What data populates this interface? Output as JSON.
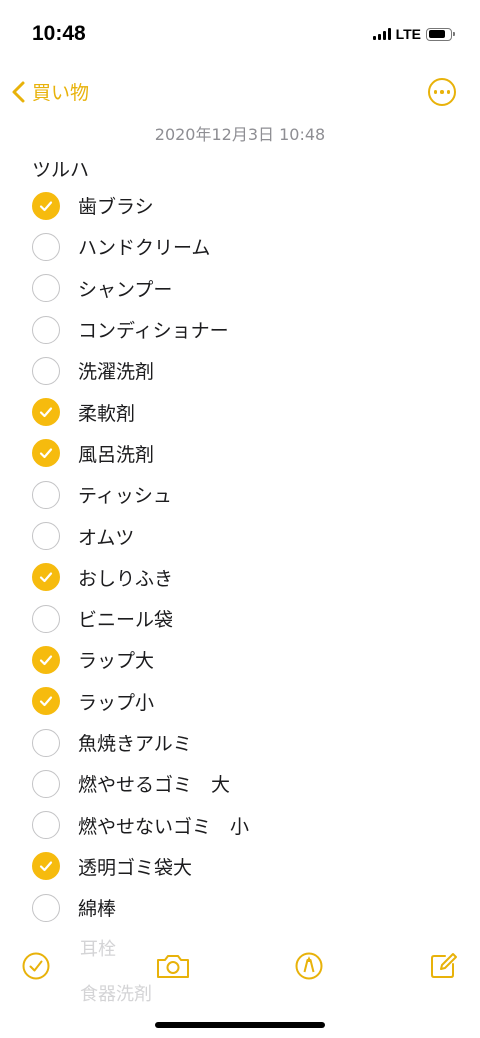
{
  "status_bar": {
    "time": "10:48",
    "network": "LTE",
    "battery_level": 0.8
  },
  "nav": {
    "back_label": "買い物"
  },
  "note": {
    "date": "2020年12月3日 10:48",
    "title": "ツルハ",
    "items": [
      {
        "label": "歯ブラシ",
        "checked": true
      },
      {
        "label": "ハンドクリーム",
        "checked": false
      },
      {
        "label": "シャンプー",
        "checked": false
      },
      {
        "label": "コンディショナー",
        "checked": false
      },
      {
        "label": "洗濯洗剤",
        "checked": false
      },
      {
        "label": "柔軟剤",
        "checked": true
      },
      {
        "label": "風呂洗剤",
        "checked": true
      },
      {
        "label": "ティッシュ",
        "checked": false
      },
      {
        "label": "オムツ",
        "checked": false
      },
      {
        "label": "おしりふき",
        "checked": true
      },
      {
        "label": "ビニール袋",
        "checked": false
      },
      {
        "label": "ラップ大",
        "checked": true
      },
      {
        "label": "ラップ小",
        "checked": true
      },
      {
        "label": "魚焼きアルミ",
        "checked": false
      },
      {
        "label": "燃やせるゴミ　大",
        "checked": false
      },
      {
        "label": "燃やせないゴミ　小",
        "checked": false
      },
      {
        "label": "透明ゴミ袋大",
        "checked": true
      },
      {
        "label": "綿棒",
        "checked": false
      }
    ],
    "overflow_faint": [
      "耳栓",
      "食器洗剤"
    ]
  },
  "toolbar": {
    "icons": [
      "checklist-icon",
      "camera-icon",
      "markup-icon",
      "compose-icon"
    ]
  },
  "colors": {
    "accent": "#e8b20a",
    "check_fill": "#f6bb0e",
    "unchecked_border": "#c4c4c6",
    "secondary_text": "#8e8e93"
  }
}
